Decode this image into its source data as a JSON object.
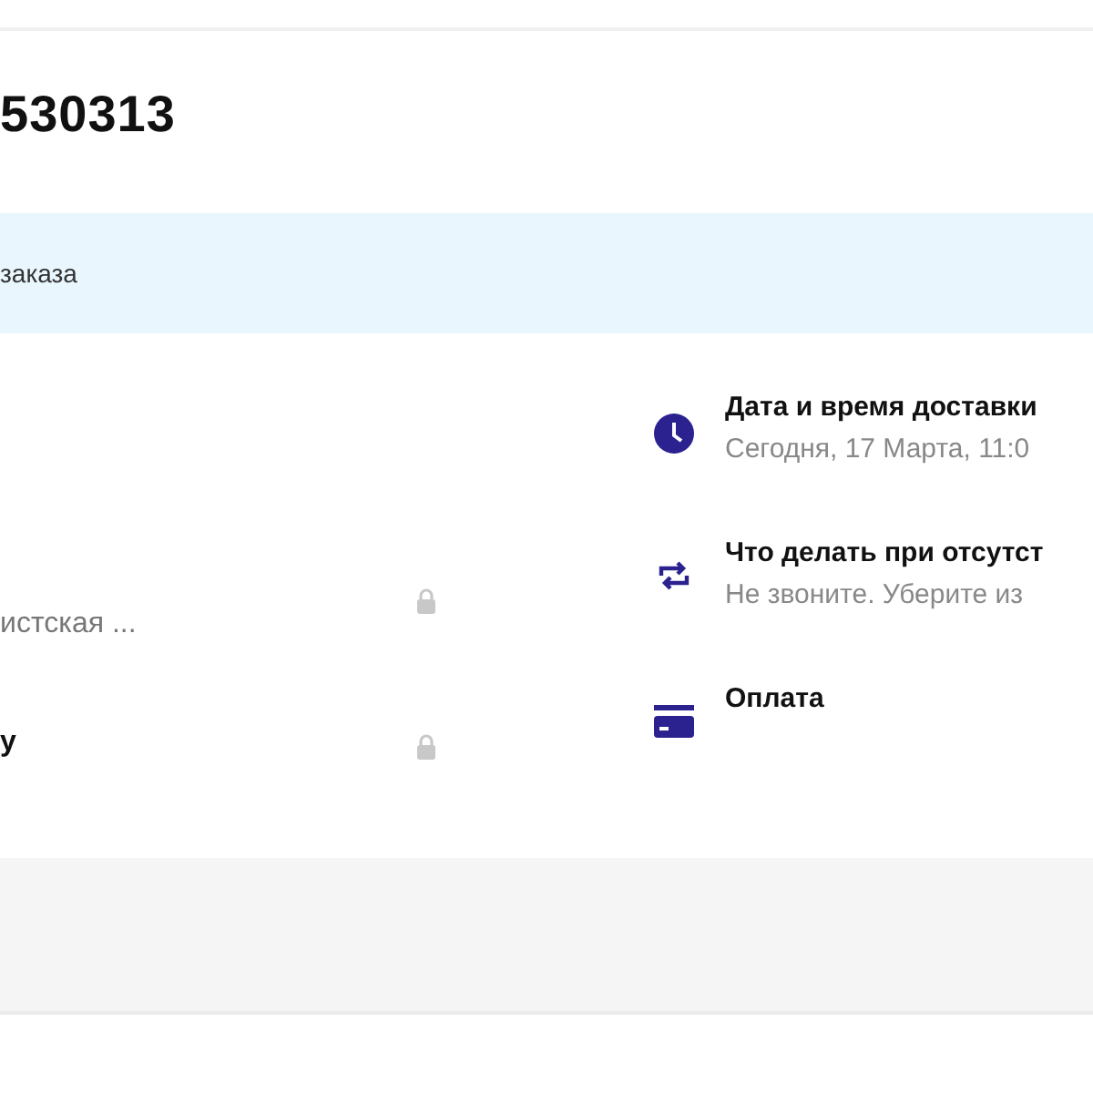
{
  "order_title": "530313",
  "notice": {
    "text": "заказа"
  },
  "left_fields": [
    {
      "kind": "value",
      "text": "истская ...",
      "locked": true
    },
    {
      "kind": "title",
      "text": "у",
      "locked": true
    }
  ],
  "right_items": [
    {
      "kind": "clock",
      "title": "Дата и время доставки",
      "subtitle": "Сегодня, 17 Марта, 11:0"
    },
    {
      "kind": "repeat",
      "title": "Что делать при отсутст",
      "subtitle": "Не звоните. Уберите из"
    },
    {
      "kind": "card",
      "title": "Оплата"
    }
  ]
}
